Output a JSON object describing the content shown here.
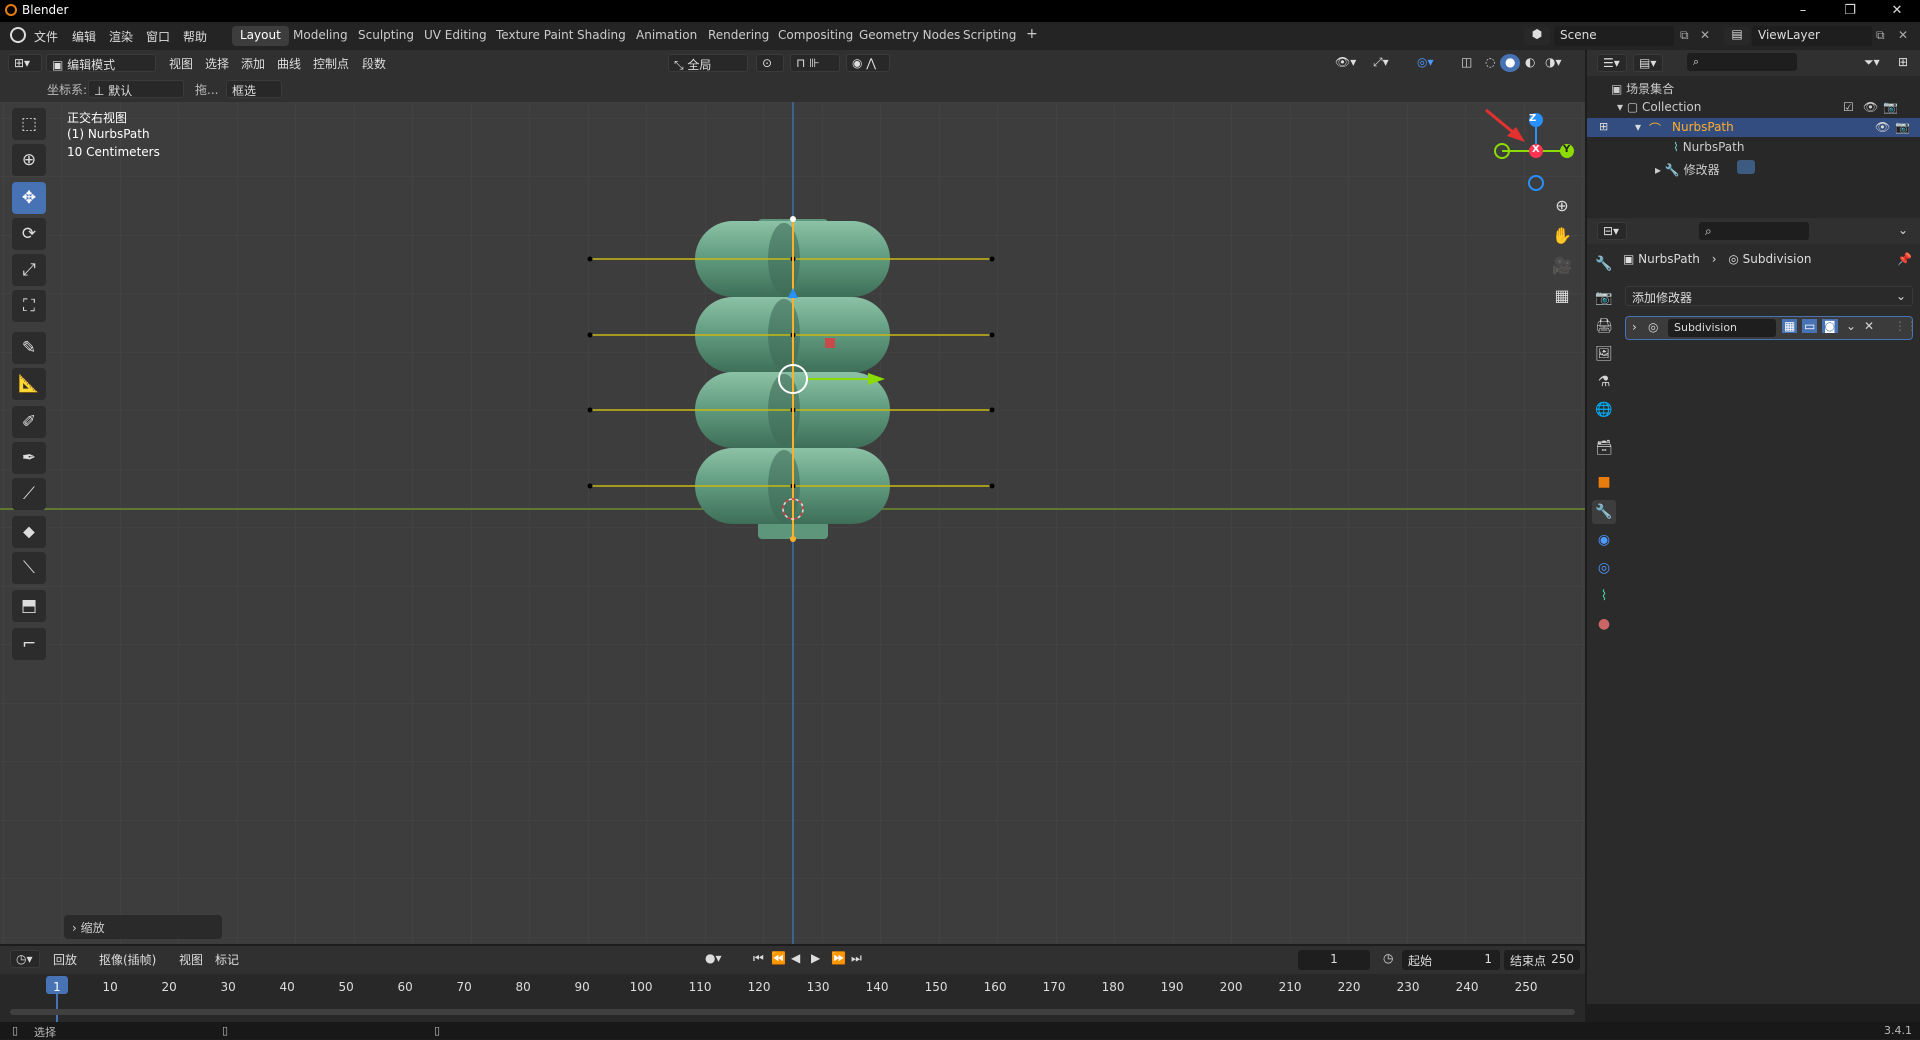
{
  "window": {
    "title": "Blender",
    "minimize": "–",
    "restore": "❐",
    "close": "✕"
  },
  "menu": [
    "文件",
    "编辑",
    "渲染",
    "窗口",
    "帮助"
  ],
  "workspaces": [
    "Layout",
    "Modeling",
    "Sculpting",
    "UV Editing",
    "Texture Paint",
    "Shading",
    "Animation",
    "Rendering",
    "Compositing",
    "Geometry Nodes",
    "Scripting"
  ],
  "active_workspace": "Layout",
  "add_workspace": "+",
  "scene": {
    "name": "Scene",
    "view_layer": "ViewLayer"
  },
  "viewport_header": {
    "mode": "编辑模式",
    "menus": [
      "视图",
      "选择",
      "添加",
      "曲线",
      "控制点",
      "段数"
    ],
    "transform_orientation": "全局"
  },
  "tool_settings": {
    "coord_label": "坐标系:",
    "coord_value": "默认",
    "drag_label": "拖...",
    "select_mode": "框选"
  },
  "overlay_text": {
    "view": "正交右视图",
    "object": "(1) NurbsPath",
    "scale": "10 Centimeters"
  },
  "gizmo": {
    "z": "Z",
    "x": "X",
    "y": "Y"
  },
  "last_op_panel": "缩放",
  "outliner": {
    "root": "场景集合",
    "collection": "Collection",
    "object": "NurbsPath",
    "data": "NurbsPath",
    "modifiers": "修改器"
  },
  "properties": {
    "breadcrumb_object": "NurbsPath",
    "breadcrumb_modifier": "Subdivision",
    "add_modifier": "添加修改器",
    "modifier_name": "Subdivision"
  },
  "timeline": {
    "menus": [
      "回放",
      "抠像(插帧)",
      "视图",
      "标记"
    ],
    "current_frame": "1",
    "start_label": "起始",
    "start_value": "1",
    "end_label": "结束点",
    "end_value": "250",
    "ticks": [
      "1",
      "10",
      "20",
      "30",
      "40",
      "50",
      "60",
      "70",
      "80",
      "90",
      "100",
      "110",
      "120",
      "130",
      "140",
      "150",
      "160",
      "170",
      "180",
      "190",
      "200",
      "210",
      "220",
      "230",
      "240",
      "250"
    ]
  },
  "status": {
    "left": "选择",
    "version": "3.4.1"
  },
  "colors": {
    "accent": "#4772b3",
    "active_object": "#ffaf29",
    "axis_x": "#ff3352",
    "axis_y": "#8bdc00",
    "axis_z": "#2890ff",
    "mesh": "#6ba88a"
  }
}
